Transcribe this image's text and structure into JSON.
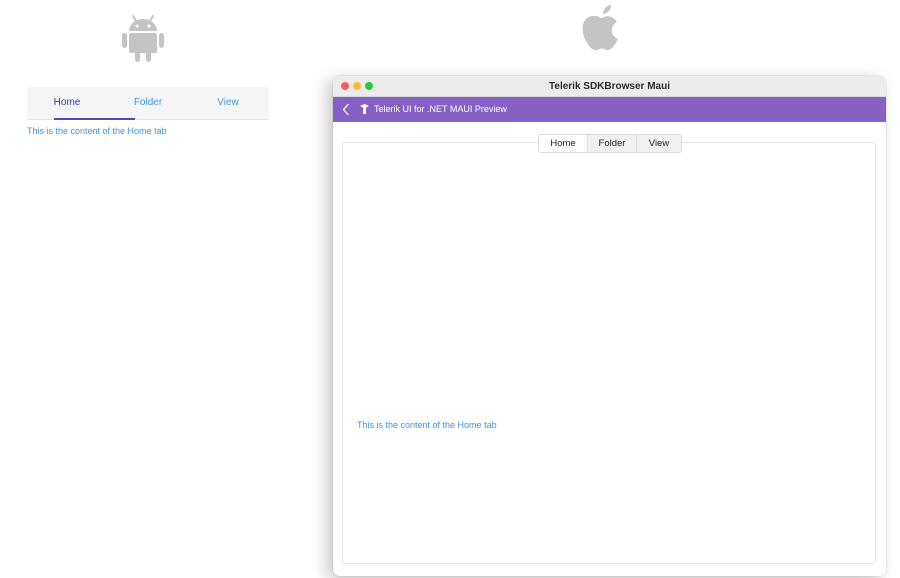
{
  "platforms": {
    "android_icon": "android-icon",
    "apple_icon": "apple-icon"
  },
  "android": {
    "tabs": [
      {
        "label": "Home",
        "selected": true
      },
      {
        "label": "Folder",
        "selected": false
      },
      {
        "label": "View",
        "selected": false
      }
    ],
    "content_text": "This is the content of the Home tab"
  },
  "mac": {
    "window_title": "Telerik SDKBrowser Maui",
    "nav_title": "Telerik UI for .NET MAUI Preview",
    "tabs": [
      {
        "label": "Home",
        "selected": true
      },
      {
        "label": "Folder",
        "selected": false
      },
      {
        "label": "View",
        "selected": false
      }
    ],
    "content_text": "This is the content of the Home tab"
  },
  "colors": {
    "accent_purple": "#8660c5",
    "link_blue": "#3f95e3",
    "selected_tab_text": "#2d3f97",
    "underline": "#4d4bbf"
  }
}
